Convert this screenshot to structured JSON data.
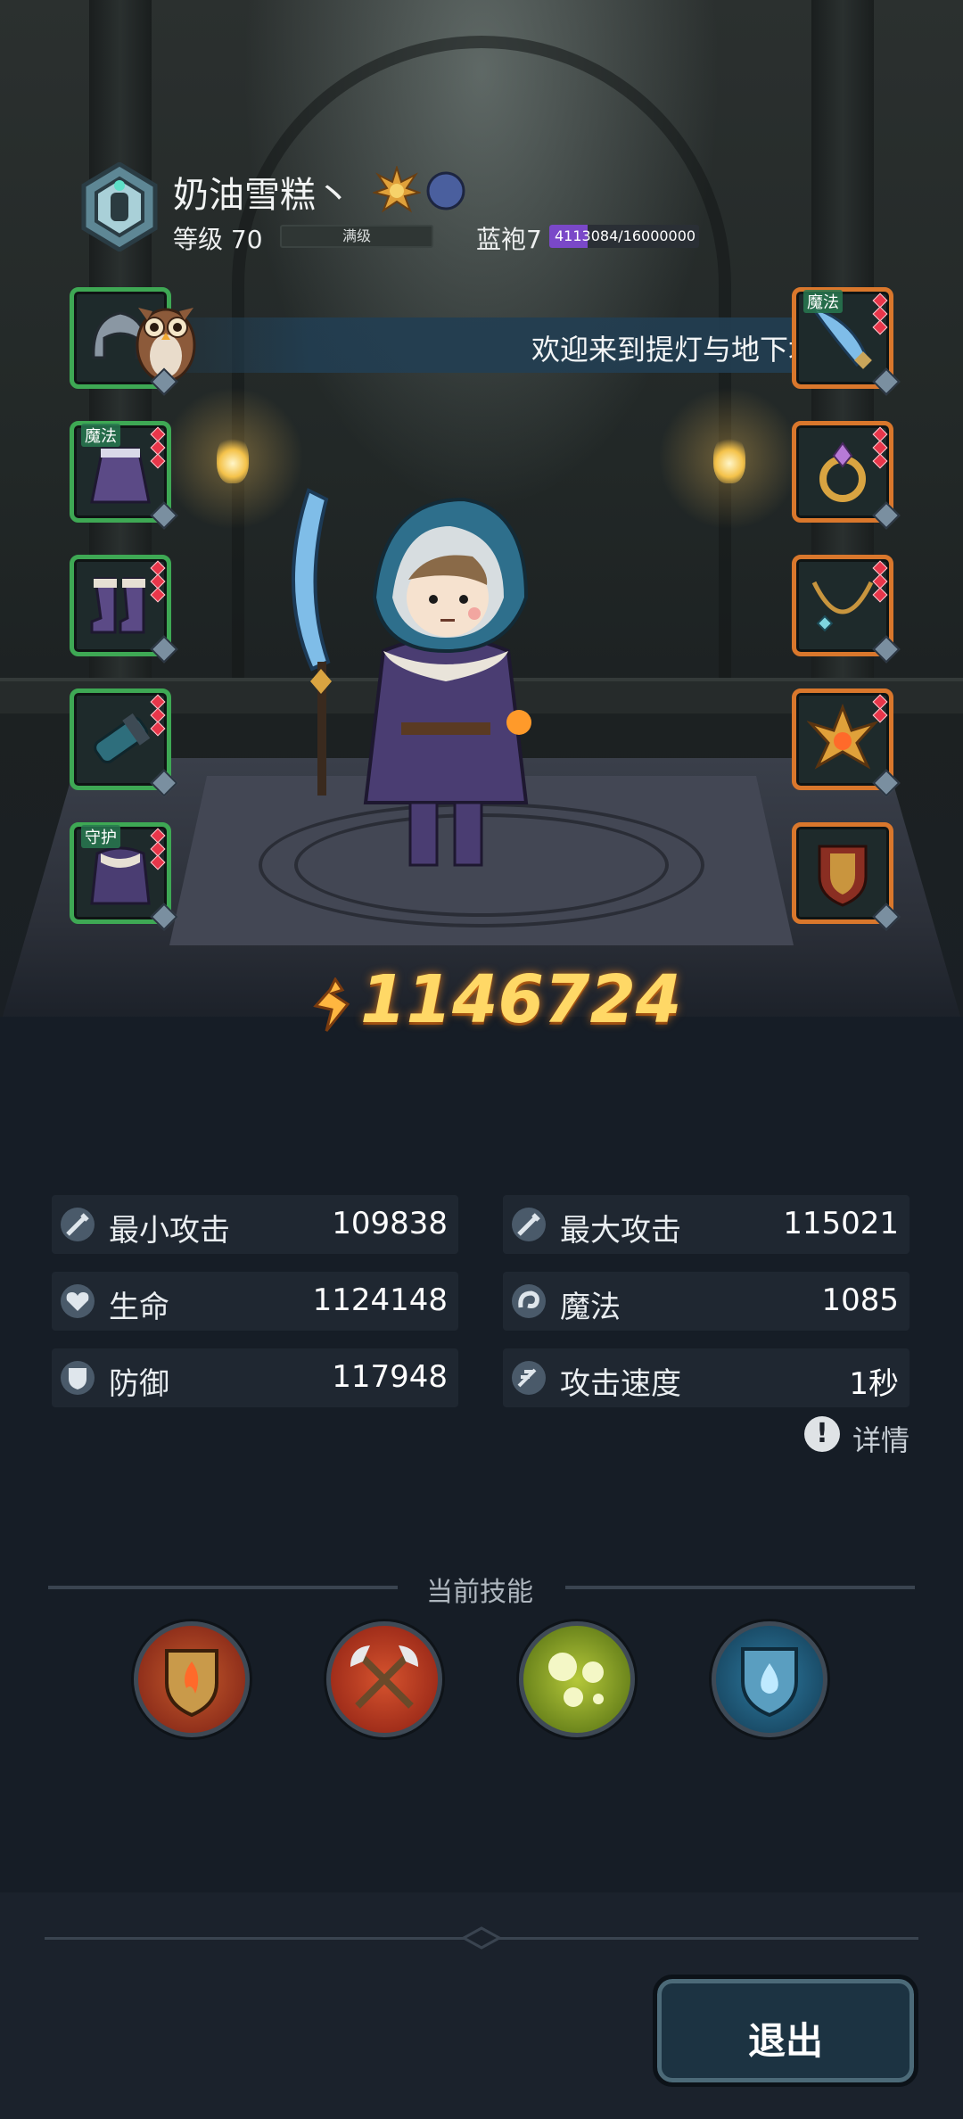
{
  "player": {
    "name": "奶油雪糕丶",
    "level_text": "等级 70",
    "level_bar_label": "满级",
    "rank_text": "蓝袍7",
    "rank_progress_text": "4113084/16000000",
    "rank_progress_fraction": 0.257
  },
  "banner": {
    "text": "欢迎来到提灯与地下城"
  },
  "equipment": {
    "left_slots": [
      {
        "name": "slot-helmet",
        "tag": "",
        "border": "green",
        "icon": "helmet-icon"
      },
      {
        "name": "slot-robe",
        "tag": "魔法",
        "border": "green",
        "icon": "robe-icon"
      },
      {
        "name": "slot-boots",
        "tag": "",
        "border": "green",
        "icon": "boots-icon"
      },
      {
        "name": "slot-bracer",
        "tag": "",
        "border": "green",
        "icon": "bracer-icon"
      },
      {
        "name": "slot-cloak",
        "tag": "守护",
        "border": "green",
        "icon": "cloak-icon"
      }
    ],
    "right_slots": [
      {
        "name": "slot-weapon",
        "tag": "魔法",
        "border": "orange",
        "icon": "blade-icon"
      },
      {
        "name": "slot-ring",
        "tag": "",
        "border": "orange",
        "icon": "ring-icon"
      },
      {
        "name": "slot-necklace",
        "tag": "",
        "border": "orange",
        "icon": "necklace-icon"
      },
      {
        "name": "slot-relic",
        "tag": "",
        "border": "orange",
        "icon": "crystal-relic-icon"
      },
      {
        "name": "slot-shield",
        "tag": "",
        "border": "orange",
        "icon": "shield-icon"
      }
    ]
  },
  "power": {
    "value": "1146724"
  },
  "stats": {
    "min_attack": {
      "label": "最小攻击",
      "value": "109838"
    },
    "max_attack": {
      "label": "最大攻击",
      "value": "115021"
    },
    "hp": {
      "label": "生命",
      "value": "1124148"
    },
    "magic": {
      "label": "魔法",
      "value": "1085"
    },
    "defense": {
      "label": "防御",
      "value": "117948"
    },
    "attack_speed": {
      "label": "攻击速度",
      "value": "1秒"
    }
  },
  "details": {
    "label": "详情",
    "icon_glyph": "!"
  },
  "skills": {
    "title": "当前技能",
    "items": [
      {
        "icon": "flame-shield-skill-icon"
      },
      {
        "icon": "crossed-axes-skill-icon"
      },
      {
        "icon": "orbs-skill-icon"
      },
      {
        "icon": "water-drop-shield-skill-icon"
      }
    ]
  },
  "exit": {
    "label": "退出"
  },
  "colors": {
    "accent_gold": "#ffd866",
    "rank_purple": "#7a48c8",
    "slot_green": "#3ea854",
    "slot_orange": "#d9772c"
  }
}
